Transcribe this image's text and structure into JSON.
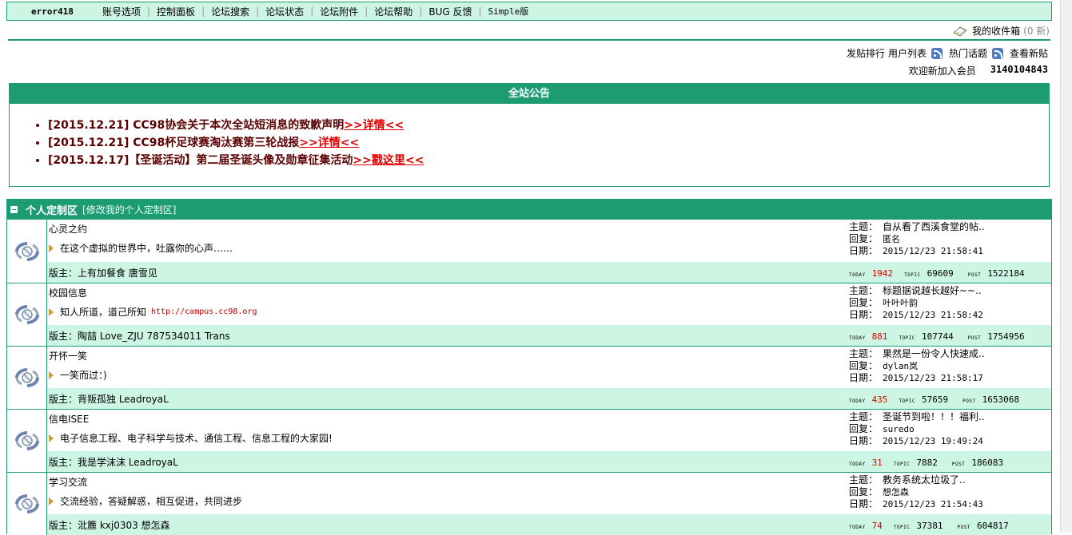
{
  "nav": {
    "username": "error418",
    "items": [
      "账号选项",
      "控制面板",
      "论坛搜索",
      "论坛状态",
      "论坛附件",
      "论坛帮助",
      "BUG 反馈",
      "Simple版"
    ]
  },
  "inbox": {
    "label": "我的收件箱",
    "count": "(0 新)"
  },
  "links": {
    "post_rank": "发贴排行",
    "user_list": "用户列表",
    "hot_topics": "热门话题",
    "new_posts": "查看新贴"
  },
  "welcome": {
    "label": "欢迎新加入会员",
    "member": "3140104843"
  },
  "announcement": {
    "title": "全站公告",
    "items": [
      {
        "text": "[2015.12.21] CC98协会关于本次全站短消息的致歉声明",
        "more": ">>详情<<"
      },
      {
        "text": "[2015.12.21] CC98杯足球赛淘汰赛第三轮战报",
        "more": ">>详情<<"
      },
      {
        "text": "[2015.12.17]【圣诞活动】第二届圣诞头像及勋章征集活动",
        "more": ">>戳这里<<"
      }
    ]
  },
  "zone": {
    "title": "个人定制区",
    "edit": "[修改我的个人定制区]",
    "boards": [
      {
        "name": "心灵之约",
        "desc": "在这个虚拟的世界中，吐露你的心声……",
        "url": "",
        "mods": "版主：上有加餐食  唐雪见",
        "topic": "自从看了西溪食堂的帖..",
        "reply": "匿名",
        "date": "2015/12/23 21:58:41",
        "today": "1942",
        "topics": "69609",
        "posts": "1522184"
      },
      {
        "name": "校园信息",
        "desc": "知人所道，道己所知",
        "url": "http://campus.cc98.org",
        "mods": "版主：陶喆  Love_ZJU  787534011  Trans",
        "topic": "标题据说越长越好~~..",
        "reply": "叶叶叶韵",
        "date": "2015/12/23 21:58:42",
        "today": "881",
        "topics": "107744",
        "posts": "1754956"
      },
      {
        "name": "开怀一笑",
        "desc": "一笑而过：)",
        "url": "",
        "mods": "版主：背叛孤独  LeadroyaL",
        "topic": "果然是一份令人快速成..",
        "reply": "dylan岚",
        "date": "2015/12/23 21:58:17",
        "today": "435",
        "topics": "57659",
        "posts": "1653068"
      },
      {
        "name": "信电ISEE",
        "desc": "电子信息工程、电子科学与技术、通信工程、信息工程的大家园!",
        "url": "",
        "mods": "版主：我是学沫沫  LeadroyaL",
        "topic": "圣诞节到啦！！！福利..",
        "reply": "suredo",
        "date": "2015/12/23 19:49:24",
        "today": "31",
        "topics": "7882",
        "posts": "186083"
      },
      {
        "name": "学习交流",
        "desc": "交流经验，答疑解惑，相互促进，共同进步",
        "url": "",
        "mods": "版主：沘簏  kxj0303  想怎森",
        "topic": "教务系统太垃圾了..",
        "reply": "想怎森",
        "date": "2015/12/23 21:54:43",
        "today": "74",
        "topics": "37381",
        "posts": "604817"
      }
    ]
  },
  "labels": {
    "topic": "主题：",
    "reply": "回复：",
    "date": "日期：",
    "today": "TODAY",
    "topic_stat": "TOPIC",
    "post": "POST"
  },
  "colors": {
    "accent": "#1d9c74",
    "light": "#cdf5e3",
    "link_red": "#e00000"
  }
}
